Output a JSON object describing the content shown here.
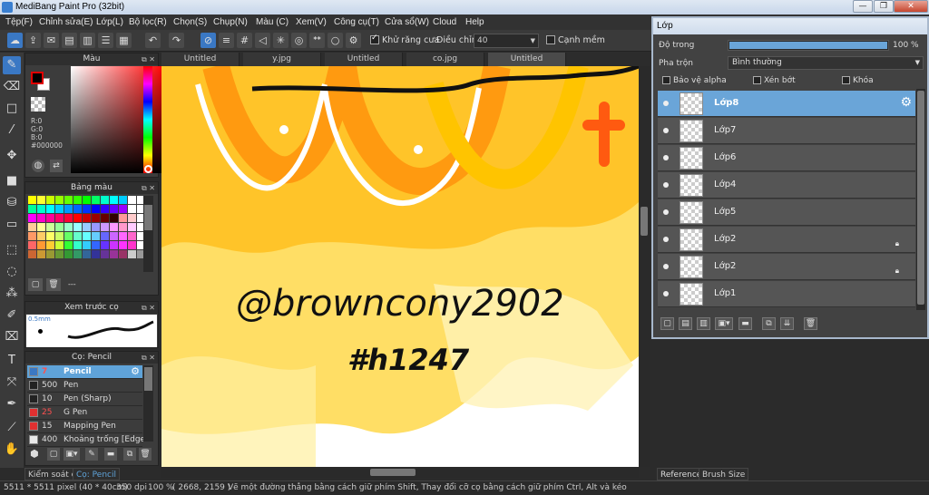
{
  "window": {
    "title": "MediBang Paint Pro (32bit)",
    "min": "—",
    "max": "❐",
    "close": "✕"
  },
  "menu": [
    "Tệp(F)",
    "Chỉnh sửa(E)",
    "Lớp(L)",
    "Bộ lọc(R)",
    "Chọn(S)",
    "Chụp(N)",
    "Màu (C)",
    "Xem(V)",
    "Công cụ(T)",
    "Cửa sổ(W)",
    "Cloud",
    "Help"
  ],
  "toolbar": {
    "antialias_label": "Khử răng cưa",
    "adjust_label": "Điều chỉnh",
    "adjust_value": "40",
    "edge_label": "Cạnh mềm"
  },
  "color_panel": {
    "title": "Màu",
    "r": "R:0",
    "g": "G:0",
    "b": "B:0",
    "hex": "#000000",
    "fg_color": "#000000",
    "bg_color": "#ffffff"
  },
  "palette_panel": {
    "title": "Bảng màu",
    "dots": "---",
    "colors": [
      "#ffff00",
      "#ffff33",
      "#ccff00",
      "#99ff00",
      "#66ff00",
      "#33ff00",
      "#00ff00",
      "#00ff66",
      "#00ffcc",
      "#00ffff",
      "#00ccff",
      "#ffffff",
      "#ffffff",
      "#00ff99",
      "#00ffcc",
      "#00ffff",
      "#00ccff",
      "#0099ff",
      "#0066ff",
      "#0033ff",
      "#0000ff",
      "#3300ff",
      "#6600ff",
      "#9900ff",
      "#ffffff",
      "#ffffff",
      "#ff00ff",
      "#ff00cc",
      "#ff0099",
      "#ff0066",
      "#ff0033",
      "#ff0000",
      "#cc0000",
      "#990000",
      "#660000",
      "#330000",
      "#ff9999",
      "#ffcccc",
      "#ffffff",
      "#ffcc99",
      "#ffff99",
      "#ccff99",
      "#99ff99",
      "#99ffcc",
      "#99ffff",
      "#99ccff",
      "#9999ff",
      "#cc99ff",
      "#ff99ff",
      "#ff99cc",
      "#ffccff",
      "#ffffff",
      "#ff9966",
      "#ffcc66",
      "#ffff66",
      "#ccff66",
      "#66ff66",
      "#66ffcc",
      "#66ffff",
      "#66ccff",
      "#6666ff",
      "#cc66ff",
      "#ff66ff",
      "#ff66cc",
      "#ffffff",
      "#ff6666",
      "#ff9933",
      "#ffcc33",
      "#ccff33",
      "#33ff33",
      "#33ffcc",
      "#33ccff",
      "#3366ff",
      "#6633ff",
      "#cc33ff",
      "#ff33ff",
      "#ff33cc",
      "#ffffff",
      "#cc6633",
      "#cc9933",
      "#999933",
      "#669933",
      "#339933",
      "#339966",
      "#336699",
      "#333399",
      "#663399",
      "#993399",
      "#993366",
      "#cccccc",
      "#999999"
    ]
  },
  "preview_panel": {
    "title": "Xem trước cọ",
    "size": "0.5mm"
  },
  "brush_panel": {
    "title": "Cọ: Pencil",
    "brushes": [
      {
        "size": "7",
        "name": "Pencil",
        "color": "#3a78c4",
        "red": true,
        "selected": true
      },
      {
        "size": "500",
        "name": "Pen",
        "color": "#222222"
      },
      {
        "size": "10",
        "name": "Pen (Sharp)",
        "color": "#222222"
      },
      {
        "size": "25",
        "name": "G Pen",
        "color": "#e03030",
        "red": true
      },
      {
        "size": "15",
        "name": "Mapping Pen",
        "color": "#e03030"
      },
      {
        "size": "400",
        "name": "Khoảng trống [Edge I",
        "color": "#e8e8e8"
      }
    ]
  },
  "bottom_left_tabs": [
    "Kiểm soát co",
    "Cọ: Pencil"
  ],
  "doc_tabs": [
    "Untitled",
    "y.jpg",
    "Untitled",
    "co.jpg",
    "Untitled"
  ],
  "canvas_text": {
    "line1": "@browncony2902",
    "line2": "#h1247"
  },
  "layer_window": {
    "title": "Lớp",
    "opacity_label": "Độ trong",
    "opacity_value": "100 %",
    "opacity_fraction": 1.0,
    "blend_label": "Pha trộn",
    "blend_value": "Bình thường",
    "protect_alpha": "Bảo vệ alpha",
    "clip": "Xén bớt",
    "lock": "Khóa",
    "layers": [
      {
        "name": "Lớp8",
        "selected": true,
        "gear": true
      },
      {
        "name": "Lớp7"
      },
      {
        "name": "Lớp6"
      },
      {
        "name": "Lớp4"
      },
      {
        "name": "Lớp5"
      },
      {
        "name": "Lớp2",
        "locked": true
      },
      {
        "name": "Lớp2",
        "locked": true
      },
      {
        "name": "Lớp1"
      }
    ]
  },
  "right_bottom_tabs": [
    "Reference",
    "Brush Size"
  ],
  "status": {
    "size": "5511 * 5511 pixel  (40 * 40cm)",
    "dpi": "350 dpi",
    "zoom": "100 %",
    "coords": "( 2668, 2159 )",
    "hint": "Vẽ một đường thẳng bằng cách giữ phím Shift, Thay đổi cỡ cọ bằng cách giữ phím Ctrl, Alt và kéo"
  }
}
